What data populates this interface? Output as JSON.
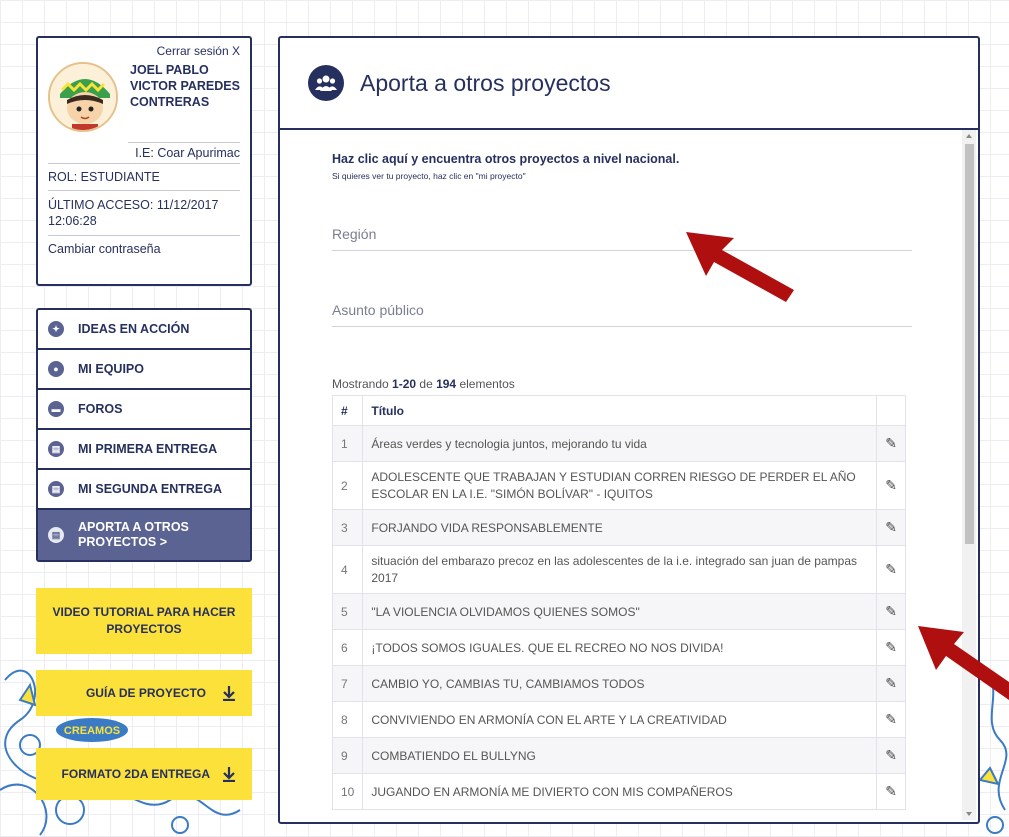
{
  "profile": {
    "logout": "Cerrar sesión X",
    "name": "JOEL PABLO VICTOR PAREDES CONTRERAS",
    "ie": "I.E: Coar Apurimac",
    "role": "ROL: ESTUDIANTE",
    "last_access": "ÚLTIMO ACCESO: 11/12/2017 12:06:28",
    "change_password": "Cambiar contraseña"
  },
  "nav": {
    "items": [
      {
        "label": "IDEAS EN ACCIÓN",
        "icon": "lightbulb-icon"
      },
      {
        "label": "MI EQUIPO",
        "icon": "team-icon"
      },
      {
        "label": "FOROS",
        "icon": "chat-icon"
      },
      {
        "label": "MI PRIMERA ENTREGA",
        "icon": "document-icon"
      },
      {
        "label": "MI SEGUNDA ENTREGA",
        "icon": "document-icon"
      },
      {
        "label": "APORTA A OTROS PROYECTOS  >",
        "icon": "document-icon",
        "active": true
      }
    ]
  },
  "sidebar_buttons": {
    "video": "VIDEO TUTORIAL PARA HACER PROYECTOS",
    "guide": "GUÍA DE PROYECTO",
    "format": "FORMATO 2DA ENTREGA"
  },
  "main": {
    "title": "Aporta a otros proyectos",
    "intro": "Haz clic aquí y encuentra otros proyectos a nivel nacional.",
    "intro_sub": "Si quieres ver tu proyecto, haz clic en \"mi proyecto\"",
    "region_placeholder": "Región",
    "asunto_placeholder": "Asunto público",
    "summary_prefix": "Mostrando ",
    "summary_range": "1-20",
    "summary_mid": " de ",
    "summary_total": "194",
    "summary_suffix": " elementos",
    "table": {
      "headers": [
        "#",
        "Título"
      ],
      "rows": [
        {
          "num": "1",
          "title": "Áreas verdes y tecnologia juntos, mejorando tu vida"
        },
        {
          "num": "2",
          "title": "ADOLESCENTE QUE TRABAJAN Y ESTUDIAN CORREN RIESGO DE PERDER EL AÑO ESCOLAR EN LA I.E. \"SIMÓN BOLÍVAR\" - IQUITOS"
        },
        {
          "num": "3",
          "title": "FORJANDO VIDA RESPONSABLEMENTE"
        },
        {
          "num": "4",
          "title": "situación del embarazo precoz en las adolescentes de la i.e. integrado san juan de pampas 2017"
        },
        {
          "num": "5",
          "title": "\"LA VIOLENCIA OLVIDAMOS QUIENES SOMOS\""
        },
        {
          "num": "6",
          "title": "¡TODOS SOMOS IGUALES. QUE EL RECREO NO NOS DIVIDA!"
        },
        {
          "num": "7",
          "title": "CAMBIO YO, CAMBIAS TU, CAMBIAMOS TODOS"
        },
        {
          "num": "8",
          "title": "CONVIVIENDO EN ARMONÍA CON EL ARTE Y LA CREATIVIDAD"
        },
        {
          "num": "9",
          "title": "COMBATIENDO EL BULLYNG"
        },
        {
          "num": "10",
          "title": "JUGANDO EN ARMONÍA ME DIVIERTO CON MIS COMPAÑEROS"
        }
      ]
    }
  },
  "decor": {
    "sticker_text": "CREAMOS"
  },
  "colors": {
    "navy": "#26305e",
    "active_nav": "#5b6392",
    "yellow": "#fbe13a",
    "arrow_red": "#b00f0f"
  }
}
